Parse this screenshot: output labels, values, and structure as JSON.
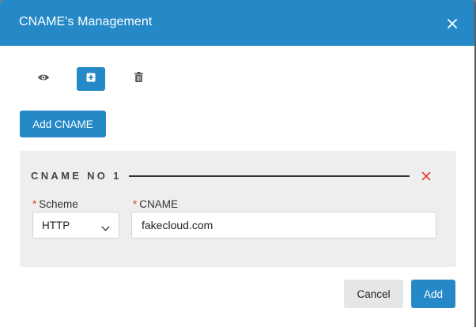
{
  "dialog": {
    "title": "CNAME's Management"
  },
  "toolbar": {
    "buttons": [
      {
        "icon": "eye-icon"
      },
      {
        "icon": "plus-square-icon",
        "active": true
      },
      {
        "icon": "trash-icon"
      }
    ]
  },
  "add_cname_label": "Add CNAME",
  "cname_section": {
    "title": "CNAME NO 1",
    "scheme": {
      "required_mark": "*",
      "label": "Scheme",
      "value": "HTTP"
    },
    "cname": {
      "required_mark": "*",
      "label": "CNAME",
      "value": "fakecloud.com"
    }
  },
  "footer": {
    "cancel_label": "Cancel",
    "add_label": "Add"
  },
  "colors": {
    "accent": "#2589c7",
    "danger": "#e53935",
    "section_bg": "#eeeeee"
  }
}
